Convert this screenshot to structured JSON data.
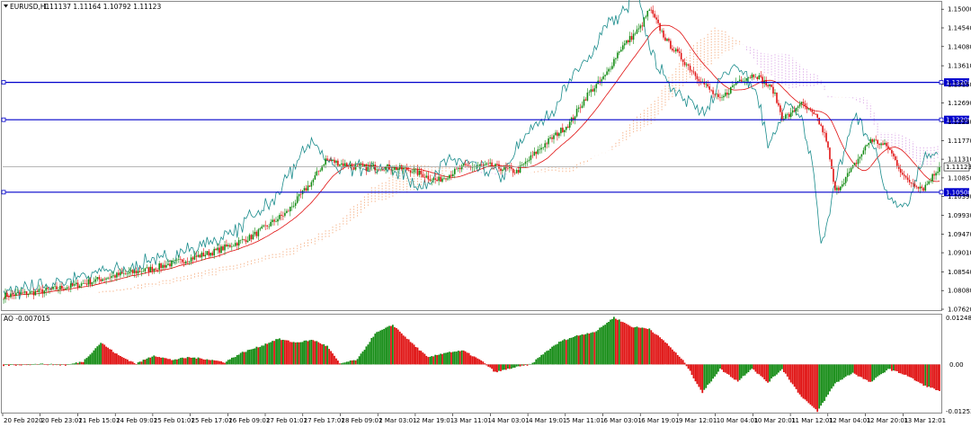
{
  "header": {
    "symbol_caption": "EURUSD,H1",
    "ohlc": "1.11137 1.11164 1.10792 1.11123"
  },
  "indicator": {
    "caption": "AO -0.007015",
    "scale_top": "0.012483",
    "scale_mid": "0.00",
    "scale_bottom": "-0.012539"
  },
  "colors": {
    "bull": "#138b13",
    "bear": "#e01010",
    "ma": "#e01010",
    "tenkan_like": "#1a8c8c",
    "cloud": "#f4a878",
    "cloud_bear": "#d9a2e6",
    "level_line": "#0000cc",
    "price_line": "#9e9e9e"
  },
  "chart_data": [
    {
      "type": "candlestick",
      "title": "EURUSD,H1",
      "price_axis_ticks": [
        1.15,
        1.1454,
        1.1408,
        1.1361,
        1.1315,
        1.1269,
        1.1223,
        1.1177,
        1.1131,
        1.1085,
        1.1039,
        1.0993,
        1.0947,
        1.0901,
        1.0854,
        1.0808,
        1.0762
      ],
      "price_axis_labels": [
        "1.15000",
        "1.14540",
        "1.14080",
        "1.13610",
        "1.13150",
        "1.12690",
        "1.12230",
        "1.11770",
        "1.11310",
        "1.10850",
        "1.10390",
        "1.09930",
        "1.09470",
        "1.09010",
        "1.08540",
        "1.08080",
        "1.07620"
      ],
      "ylim": [
        1.0762,
        1.1516
      ],
      "time_axis_labels": [
        "20 Feb 2020",
        "20 Feb 23:01",
        "21 Feb 15:01",
        "24 Feb 09:01",
        "25 Feb 01:01",
        "25 Feb 17:01",
        "26 Feb 09:01",
        "27 Feb 01:01",
        "27 Feb 17:01",
        "28 Feb 09:01",
        "2 Mar 03:01",
        "2 Mar 19:01",
        "3 Mar 11:01",
        "4 Mar 03:01",
        "4 Mar 19:01",
        "5 Mar 11:01",
        "6 Mar 03:01",
        "6 Mar 19:01",
        "9 Mar 12:01",
        "10 Mar 04:01",
        "10 Mar 20:01",
        "11 Mar 12:01",
        "12 Mar 04:01",
        "12 Mar 20:01",
        "13 Mar 12:01"
      ],
      "key_closes": [
        [
          0,
          1.0795
        ],
        [
          20,
          1.0805
        ],
        [
          40,
          1.082
        ],
        [
          60,
          1.0842
        ],
        [
          80,
          1.0858
        ],
        [
          100,
          1.088
        ],
        [
          120,
          1.0905
        ],
        [
          140,
          1.094
        ],
        [
          160,
          1.1
        ],
        [
          175,
          1.108
        ],
        [
          182,
          1.113
        ],
        [
          200,
          1.111
        ],
        [
          215,
          1.1112
        ],
        [
          230,
          1.1105
        ],
        [
          245,
          1.1078
        ],
        [
          260,
          1.1112
        ],
        [
          275,
          1.1115
        ],
        [
          290,
          1.11
        ],
        [
          305,
          1.1165
        ],
        [
          320,
          1.122
        ],
        [
          330,
          1.129
        ],
        [
          340,
          1.1335
        ],
        [
          348,
          1.14
        ],
        [
          360,
          1.1455
        ],
        [
          365,
          1.15
        ],
        [
          375,
          1.142
        ],
        [
          385,
          1.137
        ],
        [
          395,
          1.132
        ],
        [
          405,
          1.1275
        ],
        [
          415,
          1.1325
        ],
        [
          425,
          1.134
        ],
        [
          435,
          1.13
        ],
        [
          440,
          1.1235
        ],
        [
          445,
          1.124
        ],
        [
          450,
          1.127
        ],
        [
          460,
          1.123
        ],
        [
          465,
          1.118
        ],
        [
          470,
          1.105
        ],
        [
          480,
          1.111
        ],
        [
          490,
          1.118
        ],
        [
          500,
          1.116
        ],
        [
          510,
          1.108
        ],
        [
          520,
          1.106
        ],
        [
          529,
          1.1112
        ]
      ],
      "horizontal_levels": [
        {
          "value": 1.132,
          "label": "1.13200"
        },
        {
          "value": 1.1228,
          "label": "1.12200"
        },
        {
          "value": 1.105,
          "label": "1.10500"
        }
      ],
      "current_price": {
        "value": 1.11123,
        "label": "1.11123"
      },
      "bars_count": 530
    },
    {
      "type": "histogram",
      "title": "AO -0.007015",
      "ylim": [
        -0.012539,
        0.012483
      ],
      "zero_label": "0.00",
      "key_values": [
        [
          0,
          -0.0003
        ],
        [
          20,
          0.0001
        ],
        [
          35,
          -0.0002
        ],
        [
          45,
          0.0008
        ],
        [
          55,
          0.0058
        ],
        [
          65,
          0.0024
        ],
        [
          75,
          0.0002
        ],
        [
          85,
          0.0024
        ],
        [
          95,
          0.0012
        ],
        [
          105,
          0.0019
        ],
        [
          115,
          0.0014
        ],
        [
          125,
          0.0006
        ],
        [
          135,
          0.0032
        ],
        [
          145,
          0.0048
        ],
        [
          155,
          0.0068
        ],
        [
          165,
          0.0058
        ],
        [
          175,
          0.0065
        ],
        [
          183,
          0.0048
        ],
        [
          190,
          0.0002
        ],
        [
          200,
          0.0013
        ],
        [
          210,
          0.0082
        ],
        [
          220,
          0.0105
        ],
        [
          230,
          0.006
        ],
        [
          240,
          0.0018
        ],
        [
          250,
          0.0032
        ],
        [
          260,
          0.0036
        ],
        [
          270,
          0.001
        ],
        [
          278,
          -0.0021
        ],
        [
          287,
          -0.001
        ],
        [
          298,
          0.0
        ],
        [
          306,
          0.0032
        ],
        [
          315,
          0.0062
        ],
        [
          324,
          0.0076
        ],
        [
          335,
          0.0088
        ],
        [
          345,
          0.0125
        ],
        [
          355,
          0.01
        ],
        [
          365,
          0.0095
        ],
        [
          375,
          0.0055
        ],
        [
          385,
          0.0005
        ],
        [
          395,
          -0.0075
        ],
        [
          405,
          -0.0012
        ],
        [
          415,
          -0.0045
        ],
        [
          423,
          -0.001
        ],
        [
          432,
          -0.0048
        ],
        [
          440,
          -0.0012
        ],
        [
          450,
          -0.008
        ],
        [
          460,
          -0.0125
        ],
        [
          470,
          -0.005
        ],
        [
          480,
          -0.0022
        ],
        [
          490,
          -0.0048
        ],
        [
          500,
          -0.0012
        ],
        [
          510,
          -0.0028
        ],
        [
          520,
          -0.0055
        ],
        [
          529,
          -0.007
        ]
      ],
      "bars_count": 530
    }
  ]
}
